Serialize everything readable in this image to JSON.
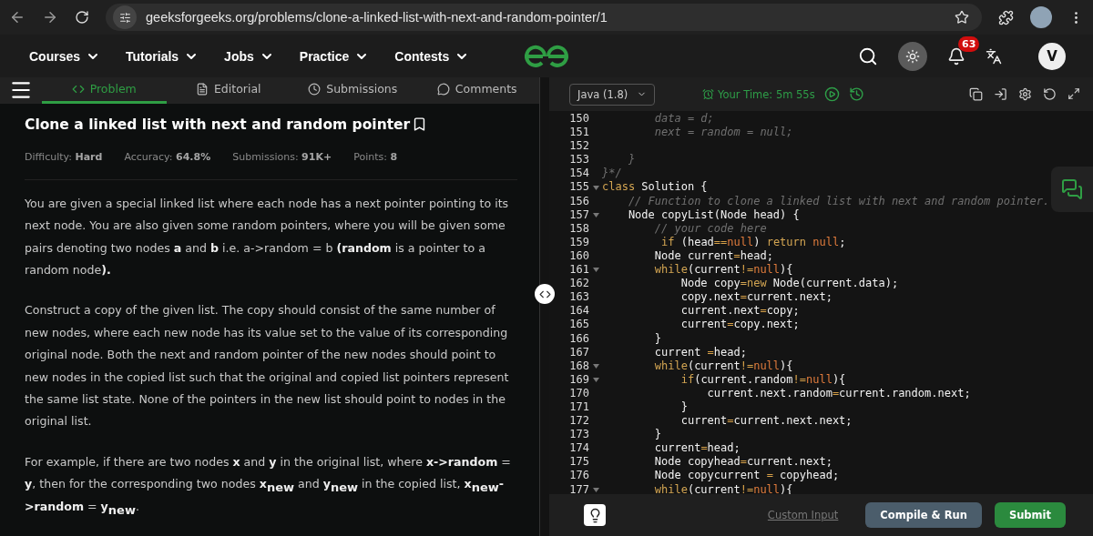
{
  "browser": {
    "url": "geeksforgeeks.org/problems/clone-a-linked-list-with-next-and-random-pointer/1"
  },
  "nav": {
    "items": [
      {
        "label": "Courses"
      },
      {
        "label": "Tutorials"
      },
      {
        "label": "Jobs"
      },
      {
        "label": "Practice"
      },
      {
        "label": "Contests"
      }
    ],
    "notifications": "63",
    "avatar": "V"
  },
  "problem_tabs": [
    {
      "label": "Problem",
      "selected": true
    },
    {
      "label": "Editorial",
      "selected": false
    },
    {
      "label": "Submissions",
      "selected": false
    },
    {
      "label": "Comments",
      "selected": false
    }
  ],
  "problem": {
    "title": "Clone a linked list with next and random pointer",
    "stats": [
      {
        "label": "Difficulty:",
        "value": "Hard"
      },
      {
        "label": "Accuracy:",
        "value": "64.8%"
      },
      {
        "label": "Submissions:",
        "value": "91K+"
      },
      {
        "label": "Points:",
        "value": "8"
      }
    ],
    "paragraphs": [
      "You are given a special linked list where each node has a next pointer pointing to its next node. You are also given some random pointers, where you will be given some pairs denoting two nodes **a** and **b** i.e. a->random = b **(random** is a pointer to a random node**).**",
      "Construct a copy of the given list. The copy should consist of the same number of new nodes, where each new node has its value set to the value of its corresponding original node. Both the next and random pointer of the new nodes should point to new nodes in the copied list such that the original and copied list pointers represent the same list state. None of the pointers in the new list should point to nodes in the original list.",
      "For example, if there are two nodes **x** and **y** in the original list, where **x->random** = **y**, then for the corresponding two nodes **x**$_{new}$ and **y**$_{new}$ in the copied list, **x**$_{new}$**->random** = **y**$_{new}$."
    ]
  },
  "editor": {
    "language": "Java (1.8)",
    "timer": "Your Time: 5m 55s",
    "lines": [
      {
        "number": "150",
        "fold": false,
        "segments": [
          {
            "text": "        data = d;",
            "kind": "comment"
          }
        ]
      },
      {
        "number": "151",
        "fold": false,
        "segments": [
          {
            "text": "        next = random = null;",
            "kind": "comment"
          }
        ]
      },
      {
        "number": "152",
        "fold": false
      },
      {
        "number": "153",
        "fold": false,
        "segments": [
          {
            "text": "    }",
            "kind": "comment"
          }
        ]
      },
      {
        "number": "154",
        "fold": false,
        "segments": [
          {
            "text": "}*/",
            "kind": "comment"
          }
        ]
      },
      {
        "number": "155",
        "fold": true,
        "segments": [
          {
            "text": "class",
            "kind": "keyword"
          },
          {
            "text": " Solution {",
            "kind": "plain"
          }
        ]
      },
      {
        "number": "156",
        "fold": false,
        "segments": [
          {
            "text": "    // Function to clone a linked list with next and random pointer.",
            "kind": "comment"
          }
        ]
      },
      {
        "number": "157",
        "fold": true,
        "segments": [
          {
            "text": "    Node copyList(Node head) {",
            "kind": "plain"
          }
        ]
      },
      {
        "number": "158",
        "fold": false,
        "segments": [
          {
            "text": "        // your code here",
            "kind": "comment"
          }
        ]
      },
      {
        "number": "159",
        "fold": false,
        "segments": [
          {
            "text": "         if",
            "kind": "keyword"
          },
          {
            "text": " (head",
            "kind": "plain"
          },
          {
            "text": "==",
            "kind": "op"
          },
          {
            "text": "null",
            "kind": "literal"
          },
          {
            "text": ") ",
            "kind": "plain"
          },
          {
            "text": "return ",
            "kind": "keyword"
          },
          {
            "text": "null",
            "kind": "literal"
          },
          {
            "text": ";",
            "kind": "plain"
          }
        ]
      },
      {
        "number": "160",
        "fold": false,
        "segments": [
          {
            "text": "        Node current",
            "kind": "plain"
          },
          {
            "text": "=",
            "kind": "op"
          },
          {
            "text": "head;",
            "kind": "plain"
          }
        ]
      },
      {
        "number": "161",
        "fold": true,
        "segments": [
          {
            "text": "        while",
            "kind": "keyword"
          },
          {
            "text": "(current",
            "kind": "plain"
          },
          {
            "text": "!=",
            "kind": "op"
          },
          {
            "text": "null",
            "kind": "literal"
          },
          {
            "text": "){",
            "kind": "plain"
          }
        ]
      },
      {
        "number": "162",
        "fold": false,
        "segments": [
          {
            "text": "            Node copy",
            "kind": "plain"
          },
          {
            "text": "=new",
            "kind": "keyword"
          },
          {
            "text": " Node(current.data);",
            "kind": "plain"
          }
        ]
      },
      {
        "number": "163",
        "fold": false,
        "segments": [
          {
            "text": "            copy.next",
            "kind": "plain"
          },
          {
            "text": "=",
            "kind": "op"
          },
          {
            "text": "current.next;",
            "kind": "plain"
          }
        ]
      },
      {
        "number": "164",
        "fold": false,
        "segments": [
          {
            "text": "            current.next",
            "kind": "plain"
          },
          {
            "text": "=",
            "kind": "op"
          },
          {
            "text": "copy;",
            "kind": "plain"
          }
        ]
      },
      {
        "number": "165",
        "fold": false,
        "segments": [
          {
            "text": "            current",
            "kind": "plain"
          },
          {
            "text": "=",
            "kind": "op"
          },
          {
            "text": "copy.next;",
            "kind": "plain"
          }
        ]
      },
      {
        "number": "166",
        "fold": false,
        "segments": [
          {
            "text": "        }",
            "kind": "plain"
          }
        ]
      },
      {
        "number": "167",
        "fold": false,
        "segments": [
          {
            "text": "        current ",
            "kind": "plain"
          },
          {
            "text": "=",
            "kind": "op"
          },
          {
            "text": "head;",
            "kind": "plain"
          }
        ]
      },
      {
        "number": "168",
        "fold": true,
        "segments": [
          {
            "text": "        while",
            "kind": "keyword"
          },
          {
            "text": "(current",
            "kind": "plain"
          },
          {
            "text": "!=",
            "kind": "op"
          },
          {
            "text": "null",
            "kind": "literal"
          },
          {
            "text": "){",
            "kind": "plain"
          }
        ]
      },
      {
        "number": "169",
        "fold": true,
        "segments": [
          {
            "text": "            if",
            "kind": "keyword"
          },
          {
            "text": "(current.random",
            "kind": "plain"
          },
          {
            "text": "!=",
            "kind": "op"
          },
          {
            "text": "null",
            "kind": "literal"
          },
          {
            "text": "){",
            "kind": "plain"
          }
        ]
      },
      {
        "number": "170",
        "fold": false,
        "segments": [
          {
            "text": "                current.next.random",
            "kind": "plain"
          },
          {
            "text": "=",
            "kind": "op"
          },
          {
            "text": "current.random.next;",
            "kind": "plain"
          }
        ]
      },
      {
        "number": "171",
        "fold": false,
        "segments": [
          {
            "text": "            }",
            "kind": "plain"
          }
        ]
      },
      {
        "number": "172",
        "fold": false,
        "segments": [
          {
            "text": "            current",
            "kind": "plain"
          },
          {
            "text": "=",
            "kind": "op"
          },
          {
            "text": "current.next.next;",
            "kind": "plain"
          }
        ]
      },
      {
        "number": "173",
        "fold": false,
        "segments": [
          {
            "text": "        }",
            "kind": "plain"
          }
        ]
      },
      {
        "number": "174",
        "fold": false,
        "segments": [
          {
            "text": "        current",
            "kind": "plain"
          },
          {
            "text": "=",
            "kind": "op"
          },
          {
            "text": "head;",
            "kind": "plain"
          }
        ]
      },
      {
        "number": "175",
        "fold": false,
        "segments": [
          {
            "text": "        Node copyhead",
            "kind": "plain"
          },
          {
            "text": "=",
            "kind": "op"
          },
          {
            "text": "current.next;",
            "kind": "plain"
          }
        ]
      },
      {
        "number": "176",
        "fold": false,
        "segments": [
          {
            "text": "        Node copycurrent ",
            "kind": "plain"
          },
          {
            "text": "=",
            "kind": "op"
          },
          {
            "text": " copyhead;",
            "kind": "plain"
          }
        ]
      },
      {
        "number": "177",
        "fold": true,
        "segments": [
          {
            "text": "        while",
            "kind": "keyword"
          },
          {
            "text": "(current",
            "kind": "plain"
          },
          {
            "text": "!=",
            "kind": "op"
          },
          {
            "text": "null",
            "kind": "literal"
          },
          {
            "text": "){",
            "kind": "plain"
          }
        ]
      }
    ],
    "custom_input": "Custom Input",
    "compile_button": "Compile & Run",
    "submit_button": "Submit"
  }
}
